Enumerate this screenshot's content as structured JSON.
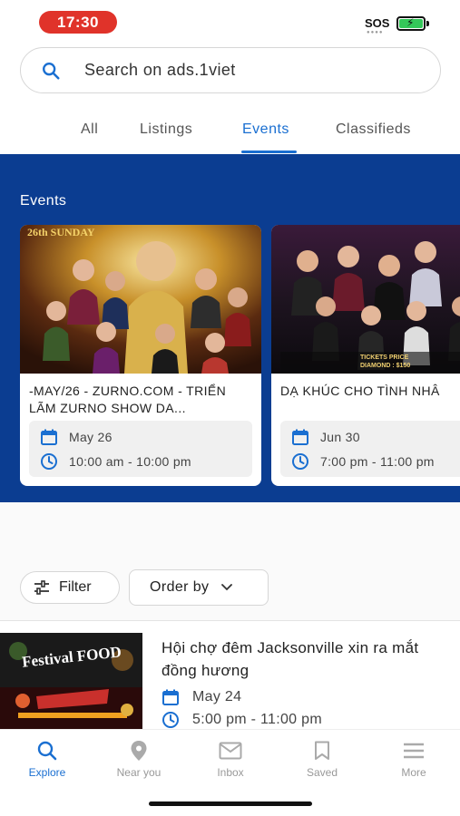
{
  "status_bar": {
    "time": "17:30",
    "sos": "SOS"
  },
  "search": {
    "placeholder": "Search on ads.1viet"
  },
  "tabs": [
    {
      "label": "All"
    },
    {
      "label": "Listings"
    },
    {
      "label": "Events"
    },
    {
      "label": "Classifieds"
    }
  ],
  "active_tab": "Events",
  "events_section": {
    "title": "Events",
    "cards": [
      {
        "poster_text": "26th SUNDAY",
        "title": "-MAY/26 - ZURNO.COM - TRIỂN LÃM ZURNO SHOW DA...",
        "date": "May 26",
        "time": "10:00 am - 10:00 pm"
      },
      {
        "poster_text": "TICKETS PRICE DIAMOND : $150",
        "title": "DẠ KHÚC CHO TÌNH NHÂ",
        "date": "Jun 30",
        "time": "7:00 pm - 11:00 pm"
      }
    ]
  },
  "filter": {
    "filter_label": "Filter",
    "order_label": "Order by"
  },
  "listings": [
    {
      "poster_text": "Festival FOOD",
      "title": "Hội chợ đêm Jacksonville xin ra mắt đồng hương",
      "date": "May 24",
      "time": "5:00 pm - 11:00 pm"
    }
  ],
  "bottom_nav": [
    {
      "label": "Explore",
      "icon": "search-icon"
    },
    {
      "label": "Near you",
      "icon": "location-pin-icon"
    },
    {
      "label": "Inbox",
      "icon": "mail-icon"
    },
    {
      "label": "Saved",
      "icon": "bookmark-icon"
    },
    {
      "label": "More",
      "icon": "menu-icon"
    }
  ],
  "colors": {
    "accent": "#1a6fd1",
    "banner": "#0b3d91",
    "time_pill": "#e0332a"
  }
}
